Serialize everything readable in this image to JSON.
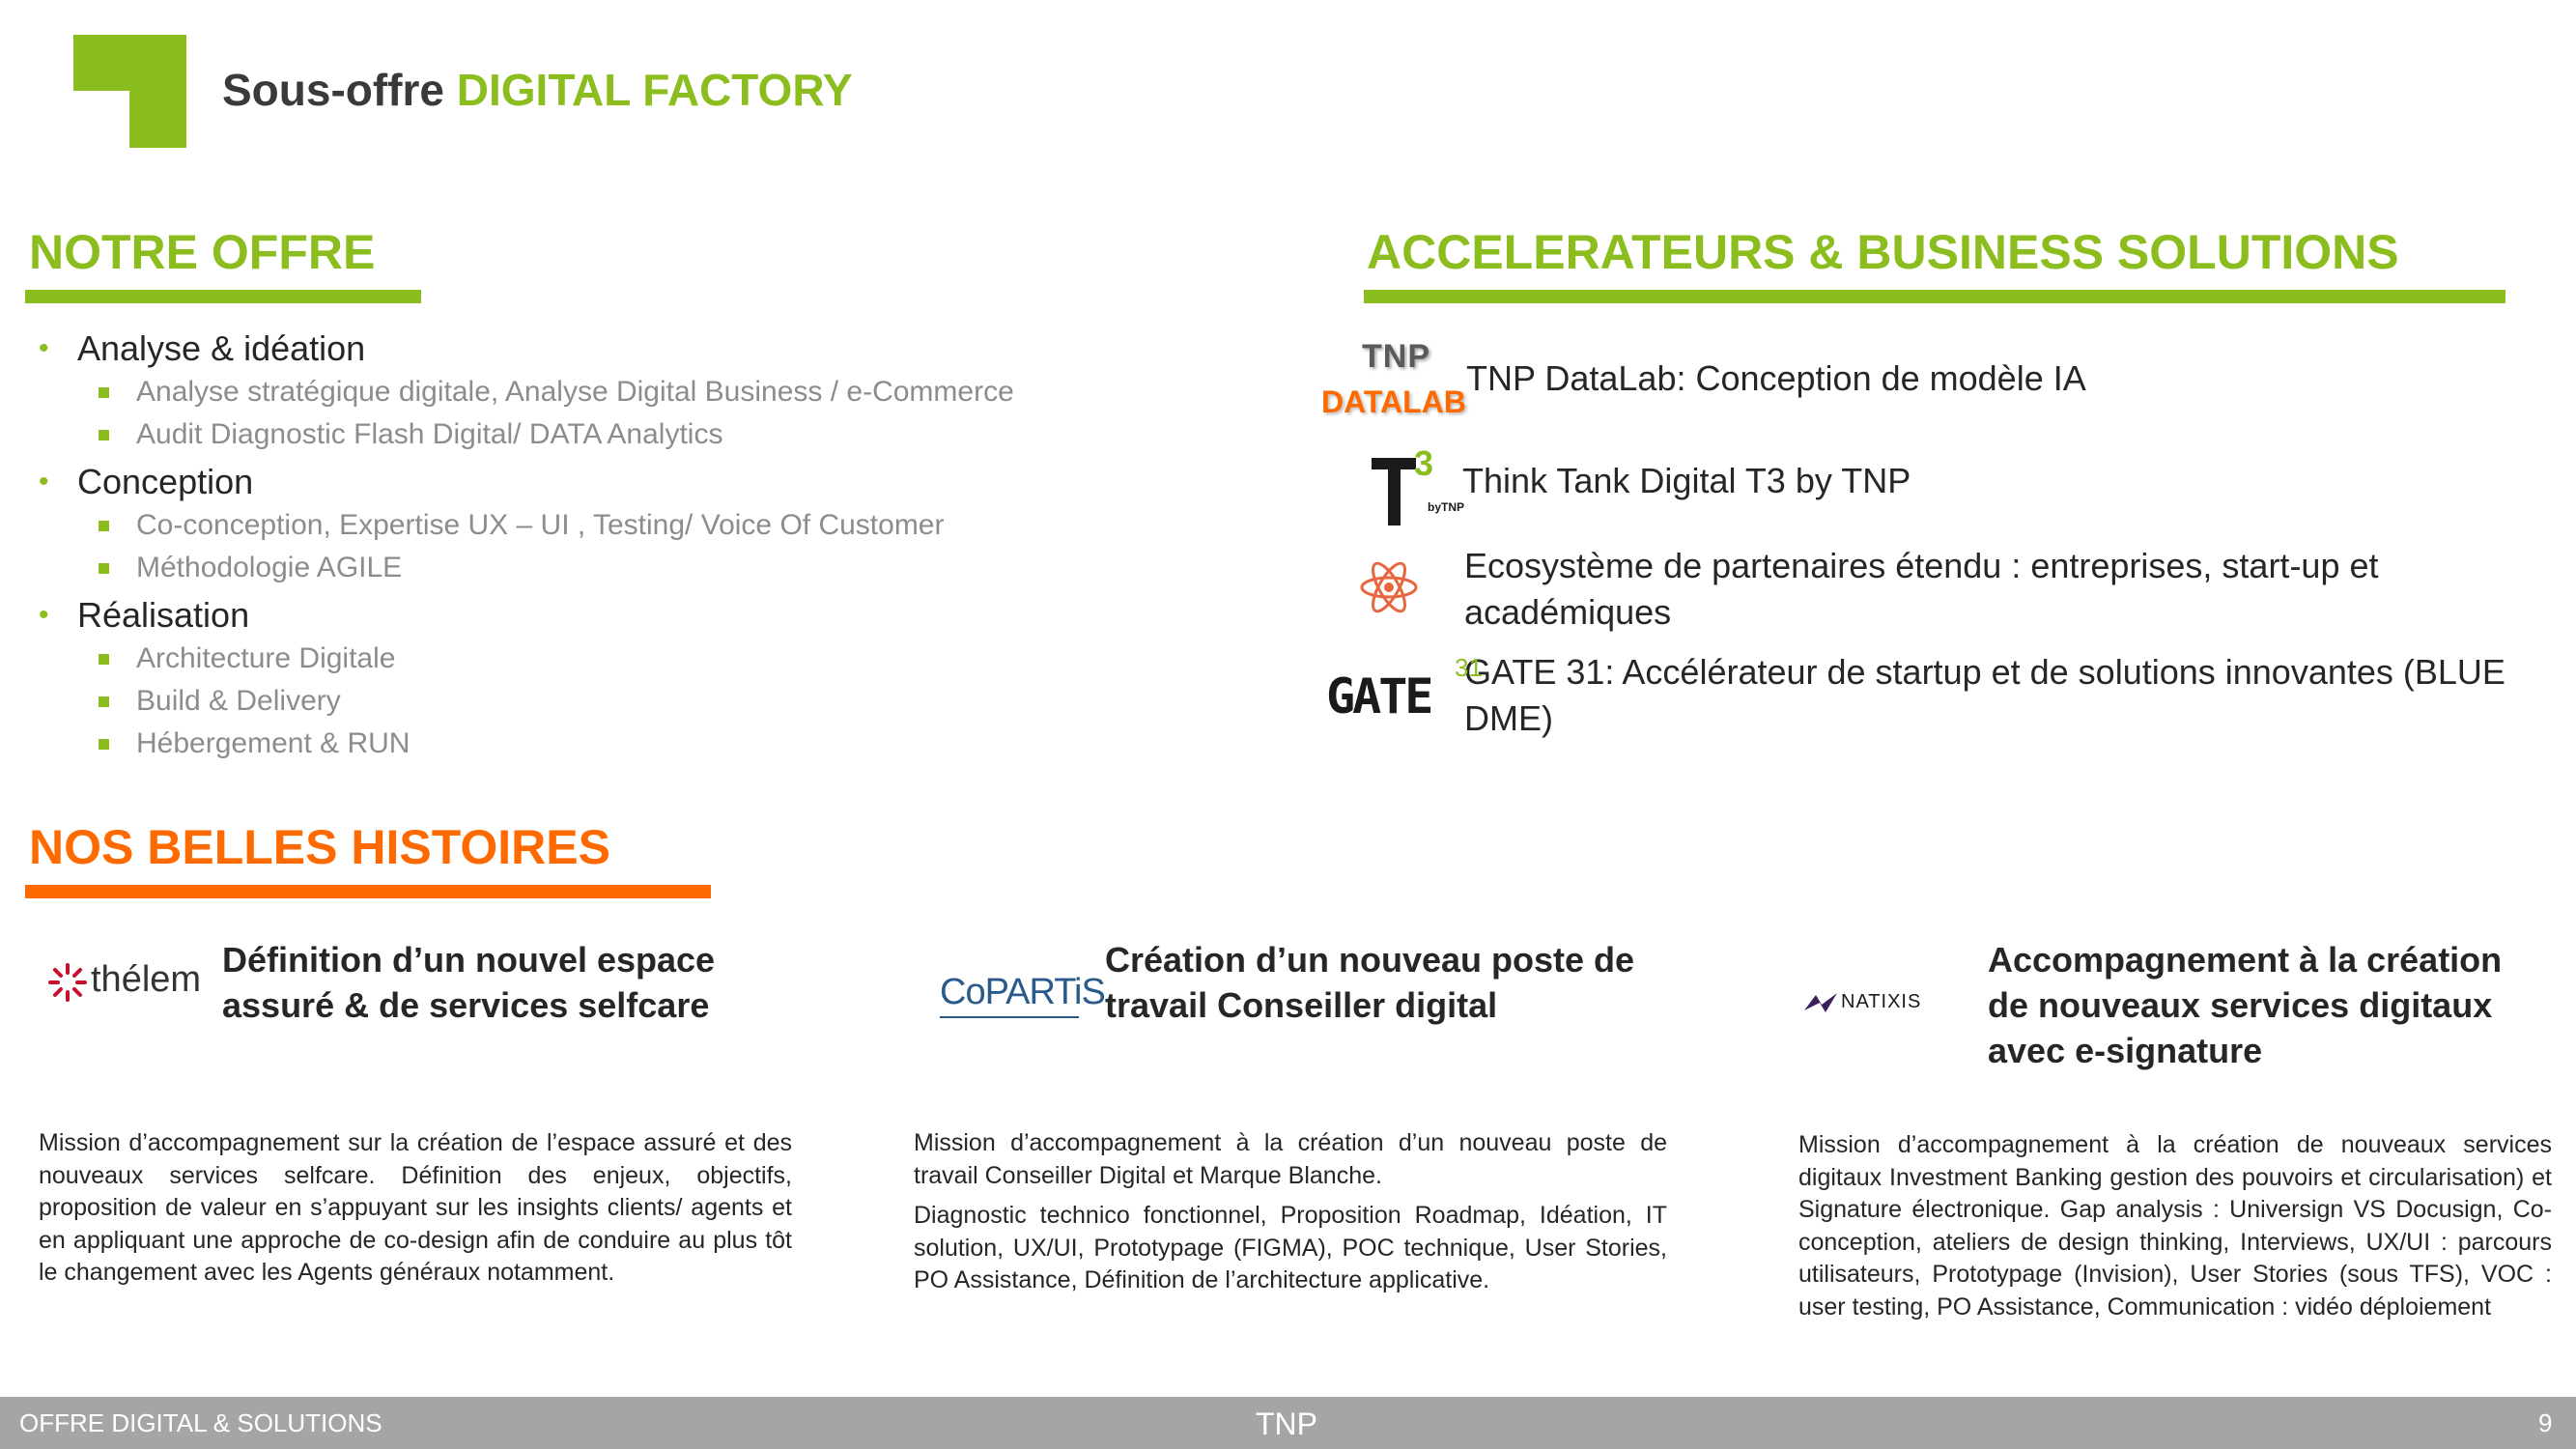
{
  "header": {
    "title_prefix": "Sous-offre",
    "title_accent": "DIGITAL FACTORY"
  },
  "colors": {
    "green": "#8cbd1e",
    "orange": "#ff6a00",
    "footer_bg": "#a5a5a5"
  },
  "offer": {
    "heading": "NOTRE OFFRE",
    "groups": [
      {
        "label": "Analyse & idéation",
        "items": [
          "Analyse stratégique digitale, Analyse Digital Business / e-Commerce",
          "Audit Diagnostic Flash Digital/ DATA Analytics"
        ]
      },
      {
        "label": "Conception",
        "items": [
          "Co-conception, Expertise UX – UI , Testing/ Voice Of Customer",
          "Méthodologie AGILE"
        ]
      },
      {
        "label": "Réalisation",
        "items": [
          "Architecture Digitale",
          "Build & Delivery",
          "Hébergement & RUN"
        ]
      }
    ]
  },
  "accelerators": {
    "heading": "ACCELERATEURS & BUSINESS SOLUTIONS",
    "items": [
      {
        "icon": "tnp-datalab-logo",
        "logo_line1": "TNP",
        "logo_line2": "DATALAB",
        "text": "TNP DataLab: Conception de modèle IA"
      },
      {
        "icon": "t3-logo",
        "logo_line1": "T3",
        "logo_line2": "byTNP",
        "text": "Think Tank Digital T3 by TNP"
      },
      {
        "icon": "atom-icon",
        "text": "Ecosystème de partenaires étendu :  entreprises, start-up et académiques"
      },
      {
        "icon": "gate31-logo",
        "logo_line1": "GATE",
        "logo_line2": "31",
        "text": "GATE 31: Accélérateur de startup et de solutions innovantes (BLUE DME)"
      }
    ]
  },
  "stories": {
    "heading": "NOS BELLES HISTOIRES",
    "items": [
      {
        "logo": "thelem-logo",
        "logo_text": "thélem",
        "title": "Définition d’un nouvel espace assuré & de services selfcare",
        "paragraphs": [
          "Mission d’accompagnement sur la création de l’espace assuré et des nouveaux services selfcare. Définition des enjeux,  objectifs, proposition de valeur en s’appuyant sur les insights clients/ agents et en appliquant une approche de co-design afin de conduire au plus tôt le changement avec les Agents généraux notamment."
        ]
      },
      {
        "logo": "copartis-logo",
        "logo_text": "CoPARTiS",
        "title": "Création d’un nouveau poste de travail Conseiller digital",
        "paragraphs": [
          "Mission d’accompagnement à la création d’un nouveau poste de travail Conseiller Digital et Marque Blanche.",
          "Diagnostic technico fonctionnel, Proposition Roadmap, Idéation, IT solution, UX/UI, Prototypage (FIGMA), POC technique, User Stories, PO Assistance, Définition de l’architecture applicative."
        ]
      },
      {
        "logo": "natixis-logo",
        "logo_text": "NATIXIS",
        "title": "Accompagnement à la création de nouveaux services digitaux avec e-signature",
        "paragraphs": [
          "Mission d’accompagnement à la création de nouveaux services digitaux Investment Banking gestion des pouvoirs et circularisation) et Signature électronique. Gap analysis : Universign VS Docusign, Co-conception, ateliers de design thinking, Interviews, UX/UI : parcours utilisateurs, Prototypage (Invision), User Stories (sous TFS), VOC : user testing, PO Assistance, Communication : vidéo déploiement"
        ]
      }
    ]
  },
  "footer": {
    "left": "OFFRE DIGITAL & SOLUTIONS",
    "center": "TNP",
    "page": "9"
  }
}
